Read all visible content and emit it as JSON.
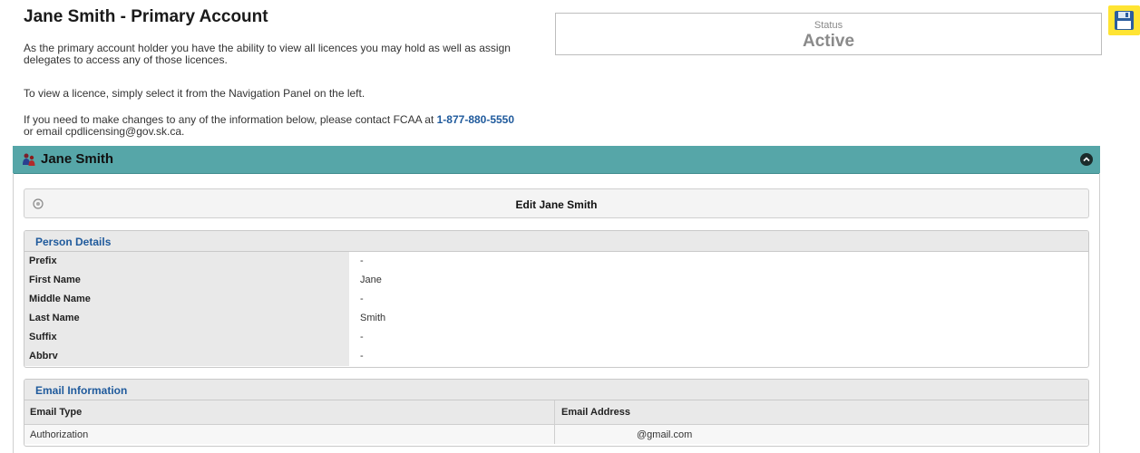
{
  "header": {
    "title": "Jane Smith - Primary Account",
    "intro_1": "As the primary account holder you have the ability to view all licences you may hold as well as assign delegates to access any of those licences.",
    "intro_2": "To view a licence, simply select it from the Navigation Panel on the left.",
    "intro_3_prefix": "If you need to make changes to any of the information below, please contact FCAA at",
    "phone": "1-877-880-5550",
    "intro_3_suffix": "or email cpdlicensing@gov.sk.ca."
  },
  "status": {
    "label": "Status",
    "value": "Active"
  },
  "toolbar": {
    "save_icon": "floppy-disk-icon"
  },
  "panel": {
    "title": "Jane Smith",
    "edit_label": "Edit Jane Smith",
    "accent_color": "#56a6a8"
  },
  "person_details": {
    "title": "Person Details",
    "rows": [
      {
        "label": "Prefix",
        "value": "-"
      },
      {
        "label": "First Name",
        "value": "Jane"
      },
      {
        "label": "Middle Name",
        "value": "-"
      },
      {
        "label": "Last Name",
        "value": "Smith"
      },
      {
        "label": "Suffix",
        "value": "-"
      },
      {
        "label": "Abbrv",
        "value": "-"
      }
    ]
  },
  "email_information": {
    "title": "Email Information",
    "columns": [
      "Email Type",
      "Email Address"
    ],
    "rows": [
      {
        "type": "Authorization",
        "address": "@gmail.com"
      }
    ]
  }
}
